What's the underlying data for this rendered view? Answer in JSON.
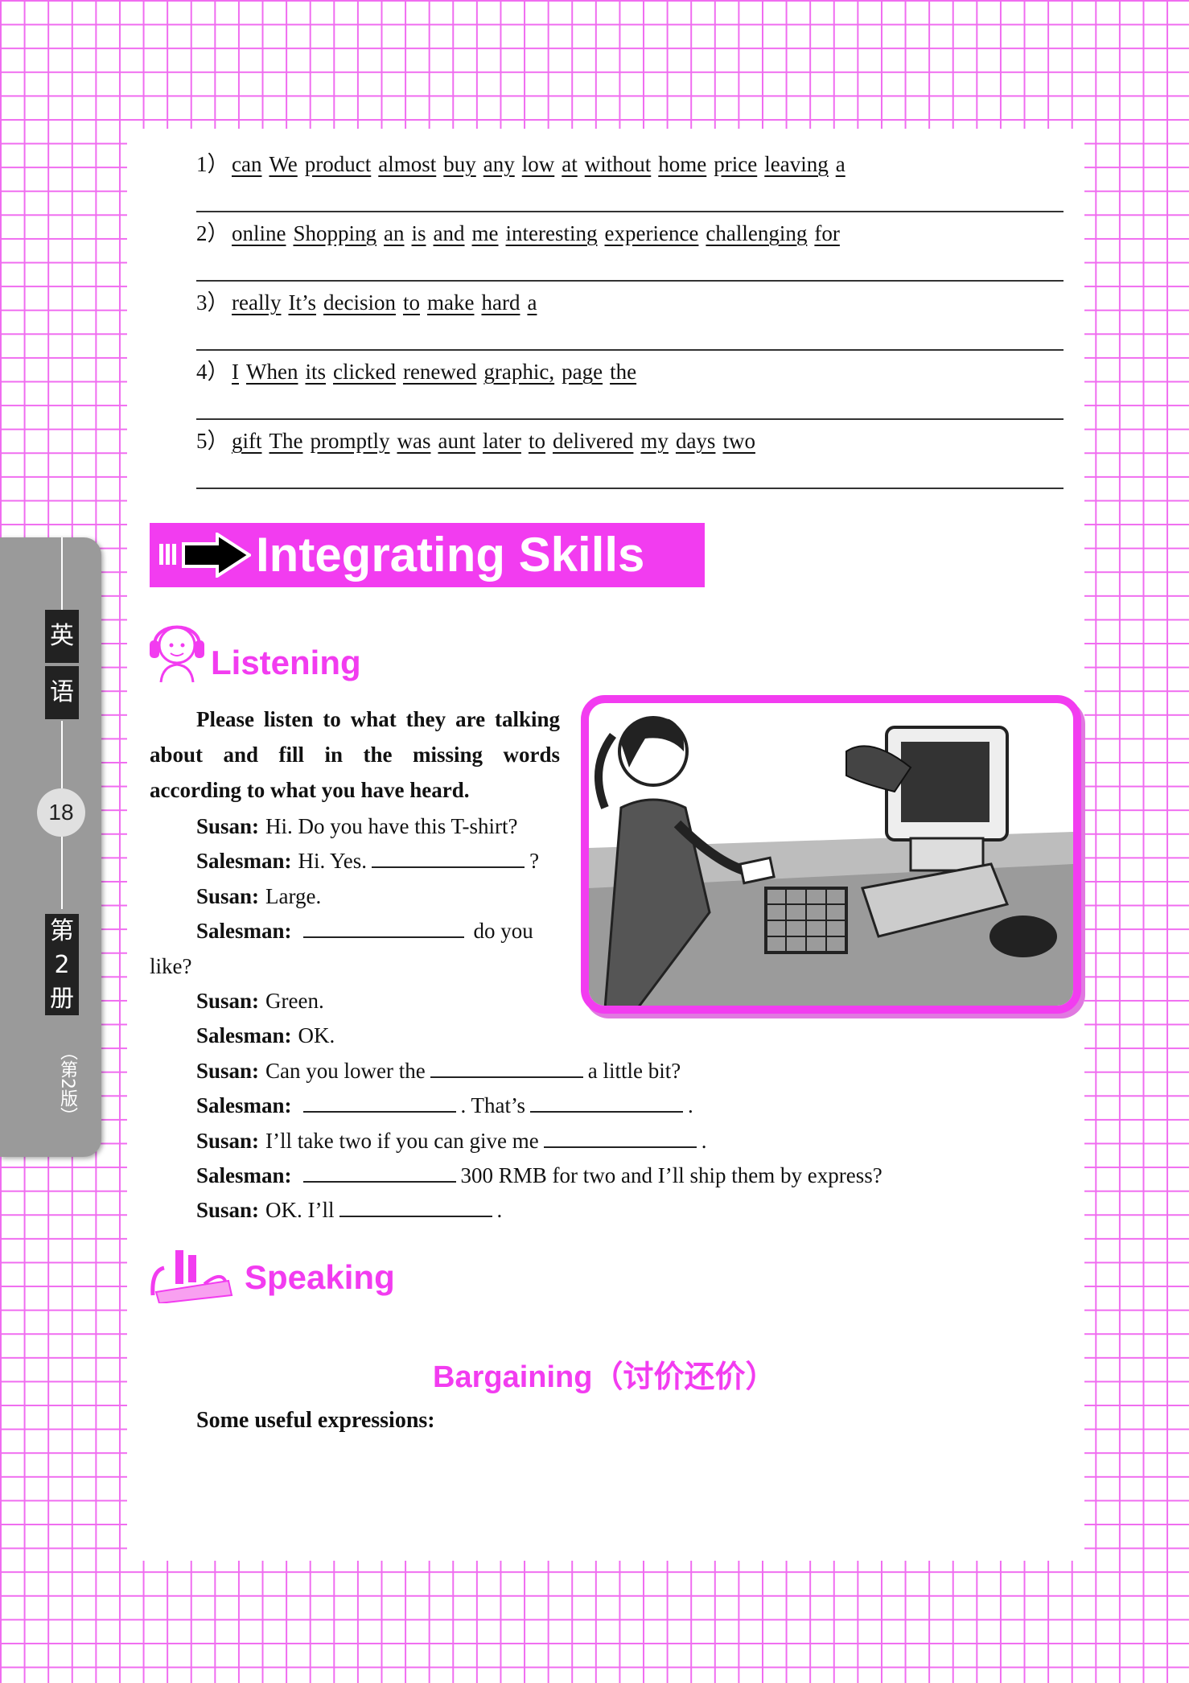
{
  "exercise": {
    "items": [
      {
        "num": "1）",
        "words": [
          "can",
          "We",
          "product",
          "almost",
          "buy",
          "any",
          "low",
          "at",
          "without",
          "home",
          "price",
          "leaving",
          "a"
        ]
      },
      {
        "num": "2）",
        "words": [
          "online",
          "Shopping",
          "an",
          "is",
          "and",
          "me",
          "interesting",
          "experience",
          "challenging",
          "for"
        ]
      },
      {
        "num": "3）",
        "words": [
          "really",
          "It’s",
          "decision",
          "to",
          "make",
          "hard",
          "a"
        ]
      },
      {
        "num": "4）",
        "words": [
          "I",
          "When",
          "its",
          "clicked",
          "renewed",
          "graphic,",
          "page",
          "the"
        ]
      },
      {
        "num": "5）",
        "words": [
          "gift",
          "The",
          "promptly",
          "was",
          "aunt",
          "later",
          "to",
          "delivered",
          "my",
          "days",
          "two"
        ]
      }
    ]
  },
  "banner": {
    "title": "Integrating Skills"
  },
  "listening": {
    "heading": "Listening",
    "instruction_first": "Please listen to what they are talking",
    "instruction_rest": "about and fill in the missing words according to what you have heard.",
    "dialogue": [
      {
        "speaker": "Susan:",
        "before": "Hi. Do you have this T-shirt?",
        "after": ""
      },
      {
        "speaker": "Salesman:",
        "before": "Hi. Yes.",
        "after": "?"
      },
      {
        "speaker": "Susan:",
        "before": "Large.",
        "after": ""
      },
      {
        "speaker": "Salesman:",
        "before": "",
        "after": "do you"
      },
      {
        "speaker": "",
        "before": "like?",
        "after": ""
      },
      {
        "speaker": "Susan:",
        "before": "Green.",
        "after": ""
      },
      {
        "speaker": "Salesman:",
        "before": "OK.",
        "after": ""
      },
      {
        "speaker": "Susan:",
        "before": "Can you lower the",
        "after": "a little bit?"
      },
      {
        "speaker": "Salesman:",
        "before": "",
        "mid": ". That’s",
        "after": "."
      },
      {
        "speaker": "Susan:",
        "before": "I’ll take two if you can give me",
        "after": "."
      },
      {
        "speaker": "Salesman:",
        "before": "",
        "after": "300 RMB for two and I’ll ship them by express?"
      },
      {
        "speaker": "Susan:",
        "before": "OK. I’ll",
        "after": "."
      }
    ]
  },
  "speaking": {
    "heading": "Speaking",
    "subtitle": "Bargaining（讨价还价）",
    "useful": "Some useful expressions:"
  },
  "sidebar": {
    "char1": "英",
    "char2": "语",
    "page_number": "18",
    "vol1": "第",
    "vol2": "2",
    "vol3": "册",
    "edition": "（第2版）"
  },
  "colors": {
    "accent": "#f23cf0",
    "grid": "#f06cf0",
    "tab": "#9a9a9a"
  }
}
